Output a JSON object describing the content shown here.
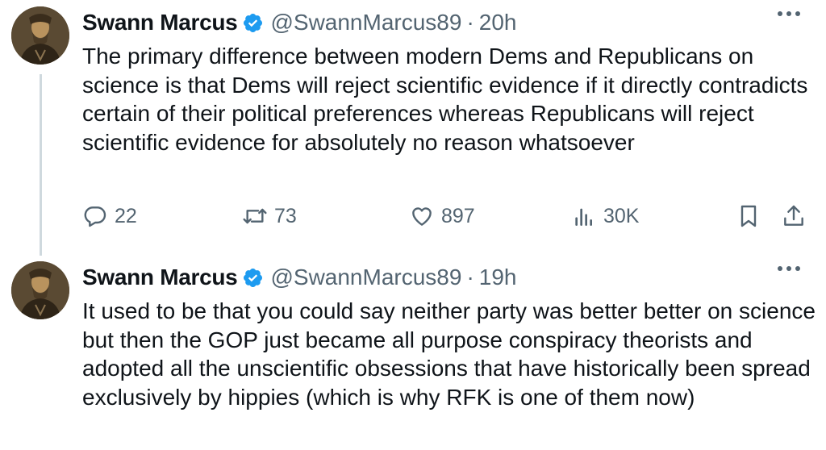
{
  "tweets": [
    {
      "author_name": "Swann Marcus",
      "handle": "@SwannMarcus89",
      "separator": "·",
      "time": "20h",
      "text": "The primary difference between modern Dems and Republicans on science is that Dems will reject scientific evidence if it directly contradicts certain of their political preferences whereas Republicans will reject scientific evidence for absolutely no reason whatsoever",
      "replies": "22",
      "retweets": "73",
      "likes": "897",
      "views": "30K"
    },
    {
      "author_name": "Swann Marcus",
      "handle": "@SwannMarcus89",
      "separator": "·",
      "time": "19h",
      "text": "It used to be that you could say neither party was better better on science but then the GOP just became all purpose conspiracy theorists and adopted all the unscientific obsessions that have historically been spread exclusively by hippies (which is why RFK is one of them now)"
    }
  ],
  "colors": {
    "verified": "#1d9bf0",
    "muted": "#536471",
    "text": "#0f1419",
    "thread_line": "#cfd9de"
  },
  "icons": [
    "verified-badge-icon",
    "more-icon",
    "reply-icon",
    "retweet-icon",
    "like-icon",
    "views-icon",
    "bookmark-icon",
    "share-icon"
  ]
}
